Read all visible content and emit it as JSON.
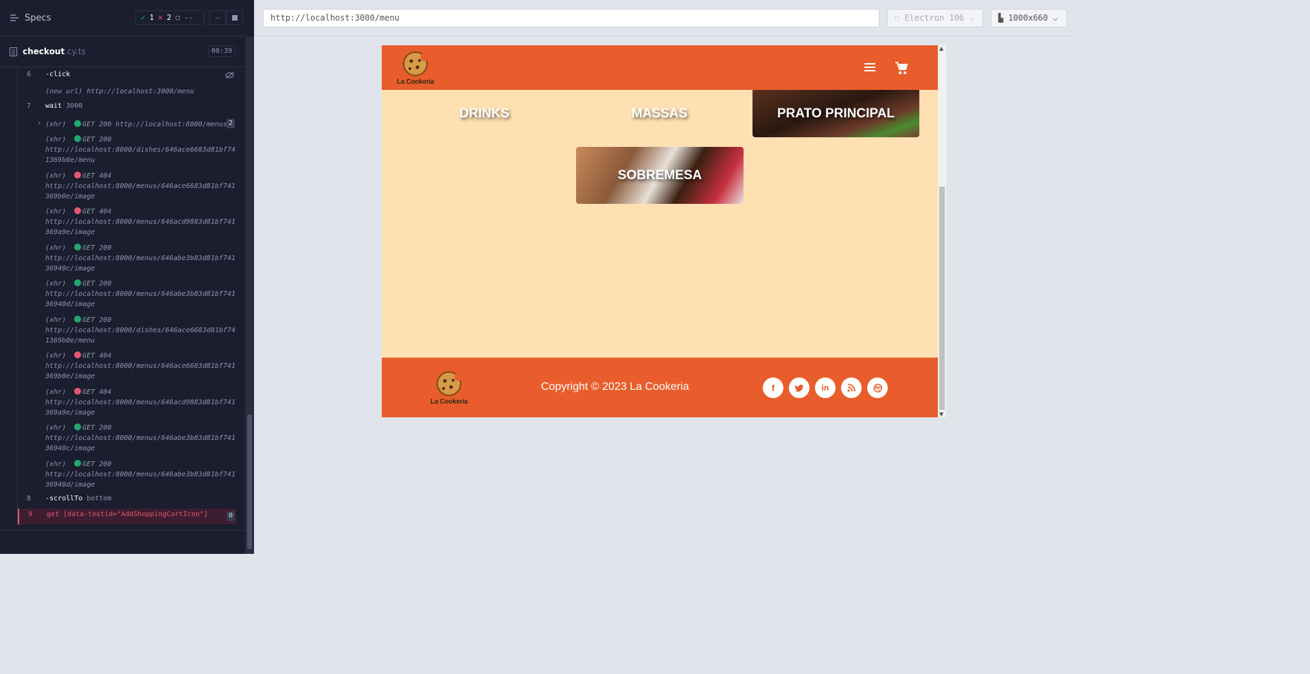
{
  "reporter": {
    "title": "Specs",
    "passed": "1",
    "failed": "2",
    "pending": "--",
    "spec_name": "checkout",
    "spec_ext": ".cy.ts",
    "duration": "00:39"
  },
  "commands": [
    {
      "num": "6",
      "name": "-click",
      "arg": ""
    },
    {
      "num": "",
      "name": "",
      "arg": "(new url)  http://localhost:3000/menu"
    },
    {
      "num": "7",
      "name": "wait",
      "arg": "3000"
    },
    {
      "num": "",
      "name": "",
      "arg": "(xhr)",
      "status": "GET 200",
      "url": "http://localhost:8000/menus",
      "count": "2"
    },
    {
      "num": "8",
      "name": "-scrollTo",
      "arg": "bottom"
    },
    {
      "num": "9",
      "name": "get",
      "arg": "[data-testid=\"AddShoppingCartIcon\"]",
      "count": "0"
    }
  ],
  "xhr_entries": [
    {
      "label": "(xhr)",
      "status": "GET 200",
      "ok": true,
      "url1": "http://localhost:8000/dishes/646ace6683d81bf74",
      "url2": "1369b0e/menu"
    },
    {
      "label": "(xhr)",
      "status": "GET 404",
      "ok": false,
      "url1": "http://localhost:8000/menus/646ace6683d81bf741",
      "url2": "369b0e/image"
    },
    {
      "label": "(xhr)",
      "status": "GET 404",
      "ok": false,
      "url1": "http://localhost:8000/menus/646acd9883d81bf741",
      "url2": "369a9e/image"
    },
    {
      "label": "(xhr)",
      "status": "GET 200",
      "ok": true,
      "url1": "http://localhost:8000/menus/646abe3b83d81bf741",
      "url2": "36940c/image"
    },
    {
      "label": "(xhr)",
      "status": "GET 200",
      "ok": true,
      "url1": "http://localhost:8000/menus/646abe3b83d81bf741",
      "url2": "36940d/image"
    },
    {
      "label": "(xhr)",
      "status": "GET 200",
      "ok": true,
      "url1": "http://localhost:8000/dishes/646ace6683d81bf74",
      "url2": "1369b0e/menu"
    },
    {
      "label": "(xhr)",
      "status": "GET 404",
      "ok": false,
      "url1": "http://localhost:8000/menus/646ace6683d81bf741",
      "url2": "369b0e/image"
    },
    {
      "label": "(xhr)",
      "status": "GET 404",
      "ok": false,
      "url1": "http://localhost:8000/menus/646acd9883d81bf741",
      "url2": "369a9e/image"
    },
    {
      "label": "(xhr)",
      "status": "GET 200",
      "ok": true,
      "url1": "http://localhost:8000/menus/646abe3b83d81bf741",
      "url2": "36940c/image"
    },
    {
      "label": "(xhr)",
      "status": "GET 200",
      "ok": true,
      "url1": "http://localhost:8000/menus/646abe3b83d81bf741",
      "url2": "36940d/image"
    }
  ],
  "browser": {
    "url": "http://localhost:3000/menu",
    "engine": "Electron 106",
    "viewport": "1000x660"
  },
  "site": {
    "logo_text": "La Cookeria",
    "categories": [
      "DRINKS",
      "MASSAS",
      "PRATO PRINCIPAL",
      "SOBREMESA"
    ],
    "copyright": "Copyright © 2023 La Cookeria",
    "social": [
      "facebook-icon",
      "twitter-icon",
      "linkedin-icon",
      "rss-icon",
      "dribbble-icon"
    ]
  },
  "colors": {
    "header": "#e85d2b",
    "page_bg": "#ffe0b3",
    "pass": "#1fa971",
    "fail": "#e45770"
  }
}
